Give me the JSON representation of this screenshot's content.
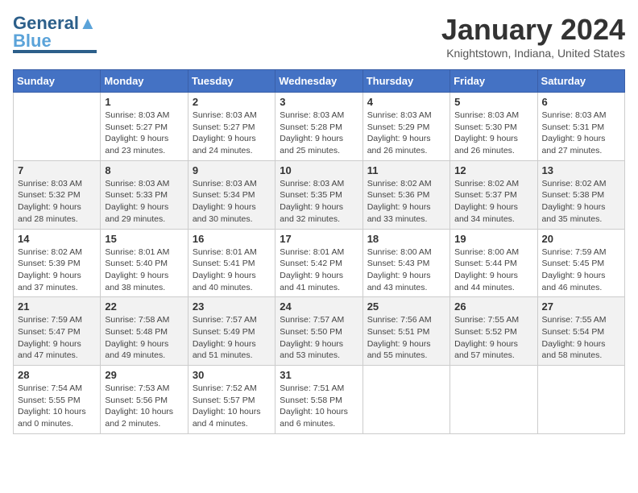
{
  "header": {
    "logo_general": "General",
    "logo_blue": "Blue",
    "month_title": "January 2024",
    "location": "Knightstown, Indiana, United States"
  },
  "days_of_week": [
    "Sunday",
    "Monday",
    "Tuesday",
    "Wednesday",
    "Thursday",
    "Friday",
    "Saturday"
  ],
  "weeks": [
    [
      {
        "day": "",
        "sunrise": "",
        "sunset": "",
        "daylight": ""
      },
      {
        "day": "1",
        "sunrise": "Sunrise: 8:03 AM",
        "sunset": "Sunset: 5:27 PM",
        "daylight": "Daylight: 9 hours and 23 minutes."
      },
      {
        "day": "2",
        "sunrise": "Sunrise: 8:03 AM",
        "sunset": "Sunset: 5:27 PM",
        "daylight": "Daylight: 9 hours and 24 minutes."
      },
      {
        "day": "3",
        "sunrise": "Sunrise: 8:03 AM",
        "sunset": "Sunset: 5:28 PM",
        "daylight": "Daylight: 9 hours and 25 minutes."
      },
      {
        "day": "4",
        "sunrise": "Sunrise: 8:03 AM",
        "sunset": "Sunset: 5:29 PM",
        "daylight": "Daylight: 9 hours and 26 minutes."
      },
      {
        "day": "5",
        "sunrise": "Sunrise: 8:03 AM",
        "sunset": "Sunset: 5:30 PM",
        "daylight": "Daylight: 9 hours and 26 minutes."
      },
      {
        "day": "6",
        "sunrise": "Sunrise: 8:03 AM",
        "sunset": "Sunset: 5:31 PM",
        "daylight": "Daylight: 9 hours and 27 minutes."
      }
    ],
    [
      {
        "day": "7",
        "sunrise": "Sunrise: 8:03 AM",
        "sunset": "Sunset: 5:32 PM",
        "daylight": "Daylight: 9 hours and 28 minutes."
      },
      {
        "day": "8",
        "sunrise": "Sunrise: 8:03 AM",
        "sunset": "Sunset: 5:33 PM",
        "daylight": "Daylight: 9 hours and 29 minutes."
      },
      {
        "day": "9",
        "sunrise": "Sunrise: 8:03 AM",
        "sunset": "Sunset: 5:34 PM",
        "daylight": "Daylight: 9 hours and 30 minutes."
      },
      {
        "day": "10",
        "sunrise": "Sunrise: 8:03 AM",
        "sunset": "Sunset: 5:35 PM",
        "daylight": "Daylight: 9 hours and 32 minutes."
      },
      {
        "day": "11",
        "sunrise": "Sunrise: 8:02 AM",
        "sunset": "Sunset: 5:36 PM",
        "daylight": "Daylight: 9 hours and 33 minutes."
      },
      {
        "day": "12",
        "sunrise": "Sunrise: 8:02 AM",
        "sunset": "Sunset: 5:37 PM",
        "daylight": "Daylight: 9 hours and 34 minutes."
      },
      {
        "day": "13",
        "sunrise": "Sunrise: 8:02 AM",
        "sunset": "Sunset: 5:38 PM",
        "daylight": "Daylight: 9 hours and 35 minutes."
      }
    ],
    [
      {
        "day": "14",
        "sunrise": "Sunrise: 8:02 AM",
        "sunset": "Sunset: 5:39 PM",
        "daylight": "Daylight: 9 hours and 37 minutes."
      },
      {
        "day": "15",
        "sunrise": "Sunrise: 8:01 AM",
        "sunset": "Sunset: 5:40 PM",
        "daylight": "Daylight: 9 hours and 38 minutes."
      },
      {
        "day": "16",
        "sunrise": "Sunrise: 8:01 AM",
        "sunset": "Sunset: 5:41 PM",
        "daylight": "Daylight: 9 hours and 40 minutes."
      },
      {
        "day": "17",
        "sunrise": "Sunrise: 8:01 AM",
        "sunset": "Sunset: 5:42 PM",
        "daylight": "Daylight: 9 hours and 41 minutes."
      },
      {
        "day": "18",
        "sunrise": "Sunrise: 8:00 AM",
        "sunset": "Sunset: 5:43 PM",
        "daylight": "Daylight: 9 hours and 43 minutes."
      },
      {
        "day": "19",
        "sunrise": "Sunrise: 8:00 AM",
        "sunset": "Sunset: 5:44 PM",
        "daylight": "Daylight: 9 hours and 44 minutes."
      },
      {
        "day": "20",
        "sunrise": "Sunrise: 7:59 AM",
        "sunset": "Sunset: 5:45 PM",
        "daylight": "Daylight: 9 hours and 46 minutes."
      }
    ],
    [
      {
        "day": "21",
        "sunrise": "Sunrise: 7:59 AM",
        "sunset": "Sunset: 5:47 PM",
        "daylight": "Daylight: 9 hours and 47 minutes."
      },
      {
        "day": "22",
        "sunrise": "Sunrise: 7:58 AM",
        "sunset": "Sunset: 5:48 PM",
        "daylight": "Daylight: 9 hours and 49 minutes."
      },
      {
        "day": "23",
        "sunrise": "Sunrise: 7:57 AM",
        "sunset": "Sunset: 5:49 PM",
        "daylight": "Daylight: 9 hours and 51 minutes."
      },
      {
        "day": "24",
        "sunrise": "Sunrise: 7:57 AM",
        "sunset": "Sunset: 5:50 PM",
        "daylight": "Daylight: 9 hours and 53 minutes."
      },
      {
        "day": "25",
        "sunrise": "Sunrise: 7:56 AM",
        "sunset": "Sunset: 5:51 PM",
        "daylight": "Daylight: 9 hours and 55 minutes."
      },
      {
        "day": "26",
        "sunrise": "Sunrise: 7:55 AM",
        "sunset": "Sunset: 5:52 PM",
        "daylight": "Daylight: 9 hours and 57 minutes."
      },
      {
        "day": "27",
        "sunrise": "Sunrise: 7:55 AM",
        "sunset": "Sunset: 5:54 PM",
        "daylight": "Daylight: 9 hours and 58 minutes."
      }
    ],
    [
      {
        "day": "28",
        "sunrise": "Sunrise: 7:54 AM",
        "sunset": "Sunset: 5:55 PM",
        "daylight": "Daylight: 10 hours and 0 minutes."
      },
      {
        "day": "29",
        "sunrise": "Sunrise: 7:53 AM",
        "sunset": "Sunset: 5:56 PM",
        "daylight": "Daylight: 10 hours and 2 minutes."
      },
      {
        "day": "30",
        "sunrise": "Sunrise: 7:52 AM",
        "sunset": "Sunset: 5:57 PM",
        "daylight": "Daylight: 10 hours and 4 minutes."
      },
      {
        "day": "31",
        "sunrise": "Sunrise: 7:51 AM",
        "sunset": "Sunset: 5:58 PM",
        "daylight": "Daylight: 10 hours and 6 minutes."
      },
      {
        "day": "",
        "sunrise": "",
        "sunset": "",
        "daylight": ""
      },
      {
        "day": "",
        "sunrise": "",
        "sunset": "",
        "daylight": ""
      },
      {
        "day": "",
        "sunrise": "",
        "sunset": "",
        "daylight": ""
      }
    ]
  ]
}
